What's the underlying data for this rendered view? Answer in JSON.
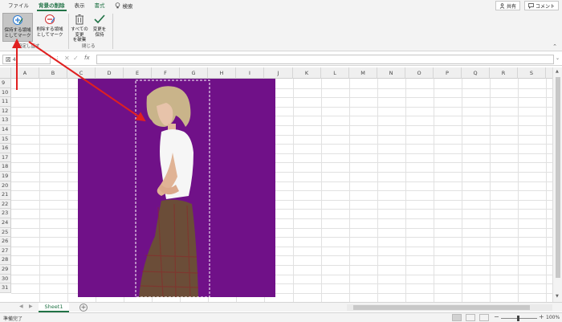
{
  "ribbon_tabs": [
    {
      "label": "ファイル",
      "state": "normal"
    },
    {
      "label": "背景の削除",
      "state": "active"
    },
    {
      "label": "表示",
      "state": "normal"
    },
    {
      "label": "書式",
      "state": "contextual"
    }
  ],
  "tell_me": {
    "label": "検索"
  },
  "top_right": {
    "share_label": "共有",
    "comments_label": "コメント"
  },
  "ribbon": {
    "keep_button": {
      "line1": "保持する領域",
      "line2": "としてマーク"
    },
    "remove_button": {
      "line1": "削除する領域",
      "line2": "としてマーク"
    },
    "discard_button": {
      "line1": "すべての変更",
      "line2": "を破棄"
    },
    "keep_changes_button": {
      "line1": "変更を",
      "line2": "保持"
    },
    "group_refine": "設定し直す",
    "group_close": "閉じる"
  },
  "formula_bar": {
    "name_box": "図 4",
    "fx": "fx",
    "value": ""
  },
  "columns": [
    "A",
    "B",
    "C",
    "D",
    "E",
    "F",
    "G",
    "H",
    "I",
    "J",
    "K",
    "L",
    "M",
    "N",
    "O",
    "P",
    "Q",
    "R",
    "S"
  ],
  "rows": [
    "9",
    "10",
    "11",
    "12",
    "13",
    "14",
    "15",
    "16",
    "17",
    "18",
    "19",
    "20",
    "21",
    "22",
    "23",
    "24",
    "25",
    "26",
    "27",
    "28",
    "29",
    "30",
    "31"
  ],
  "sheet_tabs": [
    {
      "label": "Sheet1",
      "active": true
    }
  ],
  "status": {
    "ready": "準備完了",
    "zoom": "100%"
  },
  "colors": {
    "excel_green": "#217346",
    "picture_background": "#6a0d83",
    "arrow": "#e02020"
  },
  "picture": {
    "subject": "woman-portrait-photo",
    "mode": "background-removal"
  }
}
